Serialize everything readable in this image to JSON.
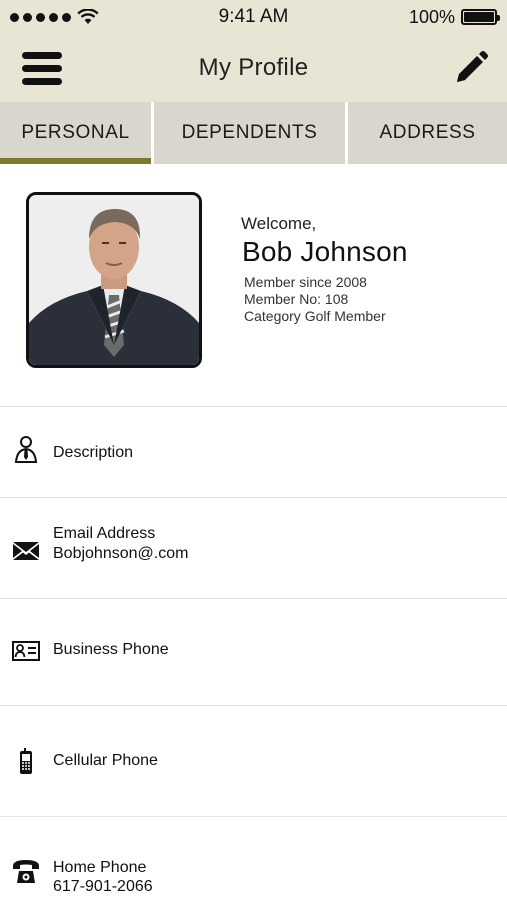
{
  "status_bar": {
    "time": "9:41 AM",
    "battery": "100%"
  },
  "header": {
    "title": "My Profile",
    "menu_icon": "hamburger-menu-icon",
    "edit_icon": "pencil-edit-icon"
  },
  "tabs": [
    {
      "label": "PERSONAL",
      "active": true
    },
    {
      "label": "DEPENDENTS",
      "active": false
    },
    {
      "label": "ADDRESS",
      "active": false
    }
  ],
  "profile": {
    "welcome": "Welcome,",
    "name": "Bob Johnson",
    "member_since": "Member since 2008",
    "member_no": "Member No: 108",
    "category": "Category Golf Member"
  },
  "fields": [
    {
      "label": "Description",
      "value": "",
      "icon": "person-tie-icon"
    },
    {
      "label": "Email Address",
      "value": "Bobjohnson@.com",
      "icon": "envelope-icon"
    },
    {
      "label": "Business Phone",
      "value": "",
      "icon": "contact-card-icon"
    },
    {
      "label": "Cellular Phone",
      "value": "",
      "icon": "mobile-phone-icon"
    },
    {
      "label": "Home Phone",
      "value": "617-901-2066",
      "icon": "telephone-icon"
    }
  ],
  "colors": {
    "header_bg": "#e8e5d4",
    "tab_bg": "#d9d6ce",
    "tab_active_indicator": "#7d7a2e"
  }
}
